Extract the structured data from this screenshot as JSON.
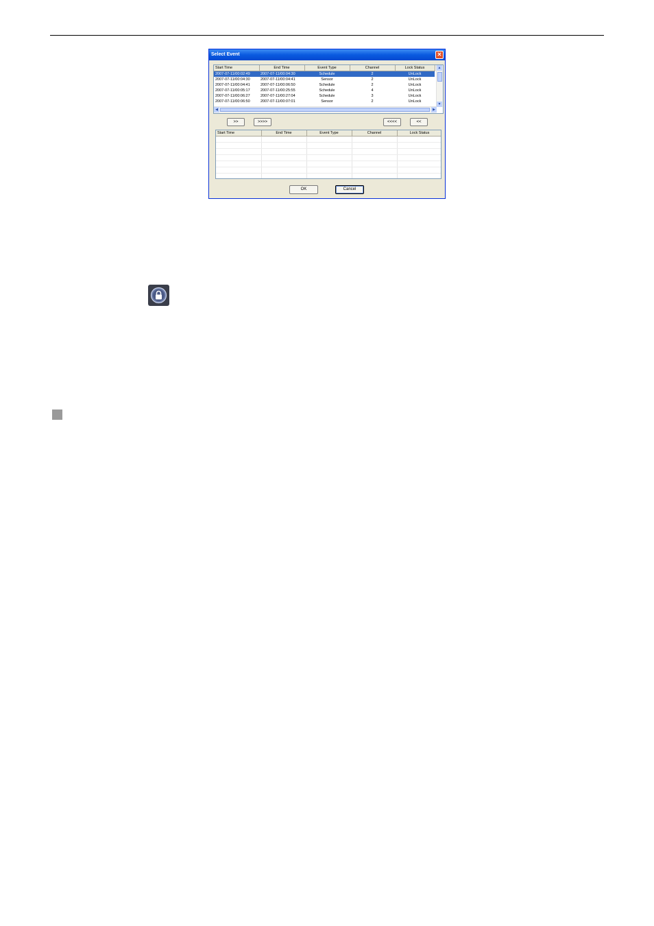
{
  "dialog": {
    "title": "Select Event",
    "columns": [
      "Start Time",
      "End Time",
      "Event Type",
      "Channel",
      "Lock Status"
    ],
    "events": [
      {
        "start": "2007-07-11/00:02:49",
        "end": "2007-07-11/00:04:30",
        "type": "Schedule",
        "channel": "2",
        "lock": "UnLock",
        "selected": true
      },
      {
        "start": "2007-07-11/00:04:30",
        "end": "2007-07-11/00:04:41",
        "type": "Sensor",
        "channel": "2",
        "lock": "UnLock"
      },
      {
        "start": "2007-07-11/00:04:41",
        "end": "2007-07-11/00:06:50",
        "type": "Schedule",
        "channel": "2",
        "lock": "UnLock"
      },
      {
        "start": "2007-07-11/00:05:17",
        "end": "2007-07-11/00:25:55",
        "type": "Schedule",
        "channel": "4",
        "lock": "UnLock"
      },
      {
        "start": "2007-07-11/00:06:27",
        "end": "2007-07-11/00:27:04",
        "type": "Schedule",
        "channel": "3",
        "lock": "UnLock"
      },
      {
        "start": "2007-07-11/00:06:50",
        "end": "2007-07-11/00:07:01",
        "type": "Sensor",
        "channel": "2",
        "lock": "UnLock"
      }
    ],
    "move_buttons": {
      "add_one": ">>",
      "add_all": ">>>>",
      "remove_all": "<<<<",
      "remove_one": "<<"
    },
    "ok_label": "OK",
    "cancel_label": "Cancel"
  },
  "icons": {
    "lock_icon": "lock-icon",
    "bullet": "square-bullet"
  },
  "colors": {
    "titlebar": "#0a5ae0",
    "selection": "#316ac5",
    "dialog_bg": "#ece9d8"
  }
}
